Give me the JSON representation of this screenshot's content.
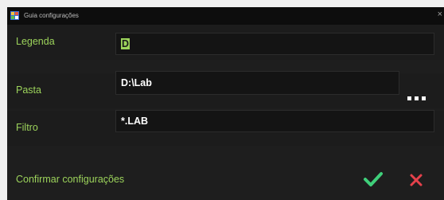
{
  "window": {
    "title": "Guia configurações",
    "close_label": "×"
  },
  "fields": {
    "legenda": {
      "label": "Legenda",
      "value_selected": "D"
    },
    "pasta": {
      "label": "Pasta",
      "value": "D:\\Lab",
      "browse_icon": "ellipsis-icon"
    },
    "filtro": {
      "label": "Filtro",
      "value": "*.LAB"
    }
  },
  "footer": {
    "confirm_text": "Confirmar configurações",
    "confirm_icon": "check-icon",
    "cancel_icon": "close-icon"
  },
  "colors": {
    "accent": "#9cd35b",
    "confirm": "#3fcf7a",
    "cancel": "#e5414b",
    "background": "#1e1e1e"
  }
}
